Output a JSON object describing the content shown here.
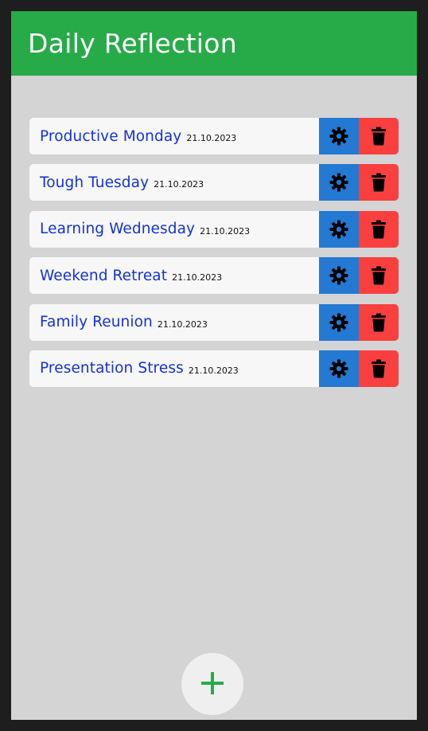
{
  "app": {
    "title": "Daily Reflection"
  },
  "entries": [
    {
      "title": "Productive Monday",
      "date": "21.10.2023"
    },
    {
      "title": "Tough Tuesday",
      "date": "21.10.2023"
    },
    {
      "title": "Learning Wednesday",
      "date": "21.10.2023"
    },
    {
      "title": "Weekend Retreat",
      "date": "21.10.2023"
    },
    {
      "title": "Family Reunion",
      "date": "21.10.2023"
    },
    {
      "title": "Presentation Stress",
      "date": "21.10.2023"
    }
  ],
  "icons": {
    "edit": "gear-icon",
    "delete": "trash-icon",
    "add": "plus-icon"
  },
  "colors": {
    "header": "#27ab48",
    "edit_button": "#2479d2",
    "delete_button": "#fa3f3f",
    "entry_title": "#1432d8",
    "add_icon": "#27ab48"
  }
}
